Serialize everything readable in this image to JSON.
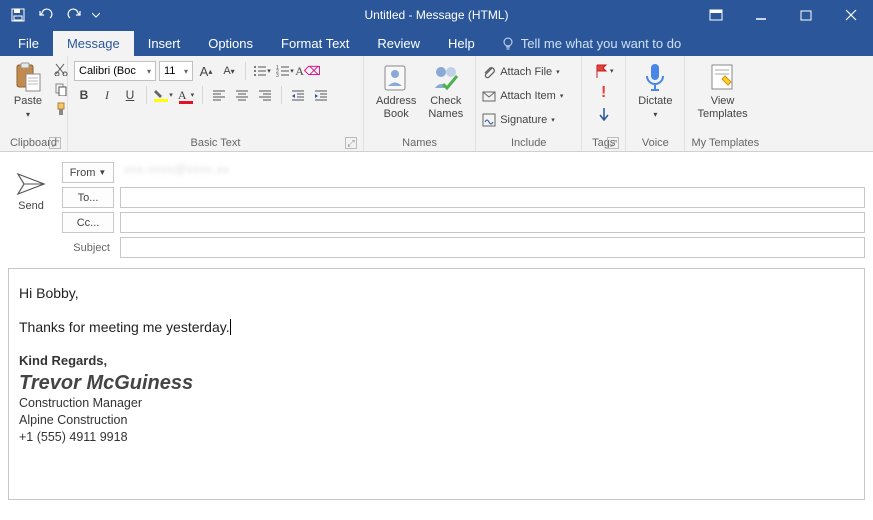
{
  "title": "Untitled  -  Message (HTML)",
  "tabs": {
    "file": "File",
    "message": "Message",
    "insert": "Insert",
    "options": "Options",
    "format": "Format Text",
    "review": "Review",
    "help": "Help",
    "tell": "Tell me what you want to do"
  },
  "ribbon": {
    "clipboard": {
      "paste": "Paste",
      "label": "Clipboard"
    },
    "basictext": {
      "font": "Calibri (Boc",
      "size": "11",
      "label": "Basic Text",
      "bold": "B",
      "italic": "I",
      "underline": "U"
    },
    "names": {
      "address": "Address\nBook",
      "check": "Check\nNames",
      "label": "Names"
    },
    "include": {
      "attachfile": "Attach File",
      "attachitem": "Attach Item",
      "signature": "Signature",
      "label": "Include"
    },
    "tags": {
      "label": "Tags"
    },
    "voice": {
      "dictate": "Dictate",
      "label": "Voice"
    },
    "templates": {
      "view": "View\nTemplates",
      "label": "My Templates"
    }
  },
  "compose": {
    "send": "Send",
    "from_btn": "From",
    "from_value": "xxx-xxxx@xxxx.xx",
    "to_btn": "To...",
    "cc_btn": "Cc...",
    "subject_label": "Subject"
  },
  "body": {
    "greeting": "Hi Bobby,",
    "line1": "Thanks for meeting me yesterday.",
    "sig_regards": "Kind Regards,",
    "sig_name": "Trevor McGuiness",
    "sig_title": "Construction Manager",
    "sig_company": "Alpine Construction",
    "sig_phone": "+1 (555) 4911 9918"
  }
}
